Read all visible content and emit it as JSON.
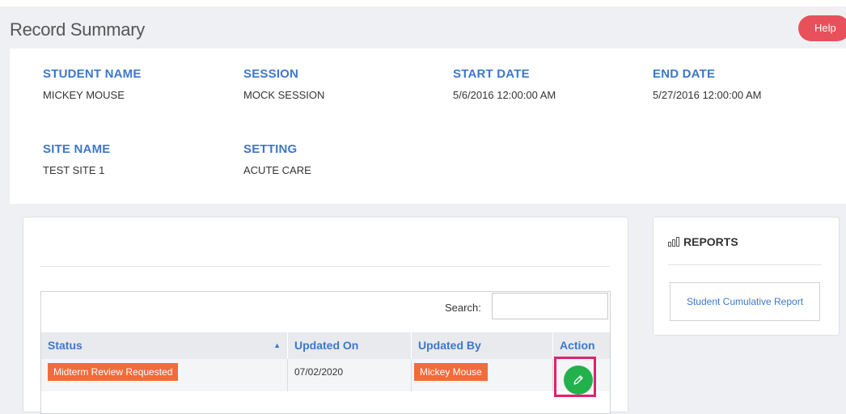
{
  "page_title": "Record Summary",
  "help_label": "Help",
  "fields": {
    "student_name": {
      "label": "STUDENT NAME",
      "value": "MICKEY MOUSE"
    },
    "session": {
      "label": "SESSION",
      "value": "MOCK SESSION"
    },
    "start_date": {
      "label": "START DATE",
      "value": "5/6/2016 12:00:00 AM"
    },
    "end_date": {
      "label": "END DATE",
      "value": "5/27/2016 12:00:00 AM"
    },
    "site_name": {
      "label": "SITE NAME",
      "value": "TEST SITE 1"
    },
    "setting": {
      "label": "SETTING",
      "value": "ACUTE CARE"
    }
  },
  "table": {
    "search_label": "Search:",
    "search_value": "",
    "headers": [
      "Status",
      "Updated On",
      "Updated By",
      "Action"
    ],
    "rows": [
      {
        "status": "Midterm Review Requested",
        "updated_on": "07/02/2020",
        "updated_by": "Mickey Mouse"
      }
    ]
  },
  "reports": {
    "heading": "REPORTS",
    "links": [
      "Student Cumulative Report"
    ]
  },
  "colors": {
    "accent_blue": "#3d78c9",
    "status_tag": "#f26b3a",
    "edit_button": "#22b14c",
    "help_button": "#e8505b",
    "highlight": "#e0216f"
  }
}
